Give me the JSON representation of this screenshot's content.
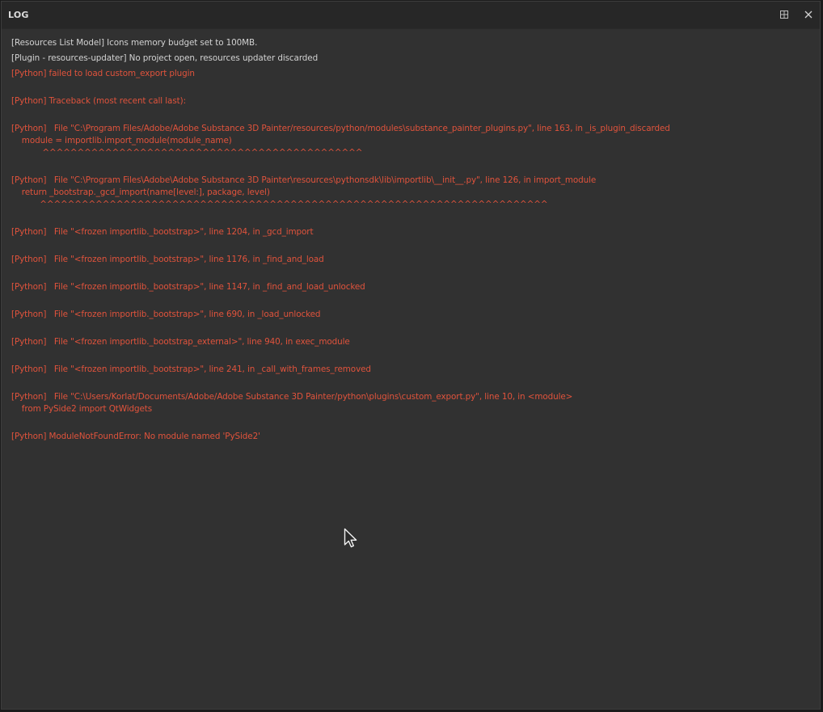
{
  "window": {
    "title": "LOG",
    "float_icon": "dock-float-icon",
    "close_icon": "close-icon"
  },
  "log": {
    "lines": [
      {
        "text": "[Resources List Model] Icons memory budget set to 100MB.",
        "level": "info"
      },
      {
        "text": "[Plugin - resources-updater] No project open, resources updater discarded",
        "level": "info"
      },
      {
        "text": "[Python] failed to load custom_export plugin",
        "level": "error"
      },
      {
        "text": "[Python] Traceback (most recent call last):",
        "level": "error"
      },
      {
        "text": "[Python]   File \"C:\\Program Files/Adobe/Adobe Substance 3D Painter/resources/python/modules\\substance_painter_plugins.py\", line 163, in _is_plugin_discarded",
        "level": "error"
      },
      {
        "text": "    module = importlib.import_module(module_name)",
        "level": "error"
      },
      {
        "text": "            ^^^^^^^^^^^^^^^^^^^^^^^^^^^^^^^^^^^^^^^^^^^^^^",
        "level": "error"
      },
      {
        "text": "[Python]   File \"C:\\Program Files\\Adobe\\Adobe Substance 3D Painter\\resources\\pythonsdk\\lib\\importlib\\__init__.py\", line 126, in import_module",
        "level": "error"
      },
      {
        "text": "    return _bootstrap._gcd_import(name[level:], package, level)",
        "level": "error"
      },
      {
        "text": "           ^^^^^^^^^^^^^^^^^^^^^^^^^^^^^^^^^^^^^^^^^^^^^^^^^^^^^^^^^^^^^^^^^^^^^^^^^",
        "level": "error"
      },
      {
        "text": "[Python]   File \"<frozen importlib._bootstrap>\", line 1204, in _gcd_import",
        "level": "error"
      },
      {
        "text": "[Python]   File \"<frozen importlib._bootstrap>\", line 1176, in _find_and_load",
        "level": "error"
      },
      {
        "text": "[Python]   File \"<frozen importlib._bootstrap>\", line 1147, in _find_and_load_unlocked",
        "level": "error"
      },
      {
        "text": "[Python]   File \"<frozen importlib._bootstrap>\", line 690, in _load_unlocked",
        "level": "error"
      },
      {
        "text": "[Python]   File \"<frozen importlib._bootstrap_external>\", line 940, in exec_module",
        "level": "error"
      },
      {
        "text": "[Python]   File \"<frozen importlib._bootstrap>\", line 241, in _call_with_frames_removed",
        "level": "error"
      },
      {
        "text": "[Python]   File \"C:\\Users/Korlat/Documents/Adobe/Adobe Substance 3D Painter/python\\plugins\\custom_export.py\", line 10, in <module>",
        "level": "error"
      },
      {
        "text": "    from PySide2 import QtWidgets",
        "level": "error"
      },
      {
        "text": "[Python] ModuleNotFoundError: No module named 'PySide2'",
        "level": "error"
      }
    ]
  },
  "colors": {
    "info": "#d2d2d2",
    "error": "#e0533c",
    "panel_bg": "#313131",
    "header_bg": "#272727"
  }
}
